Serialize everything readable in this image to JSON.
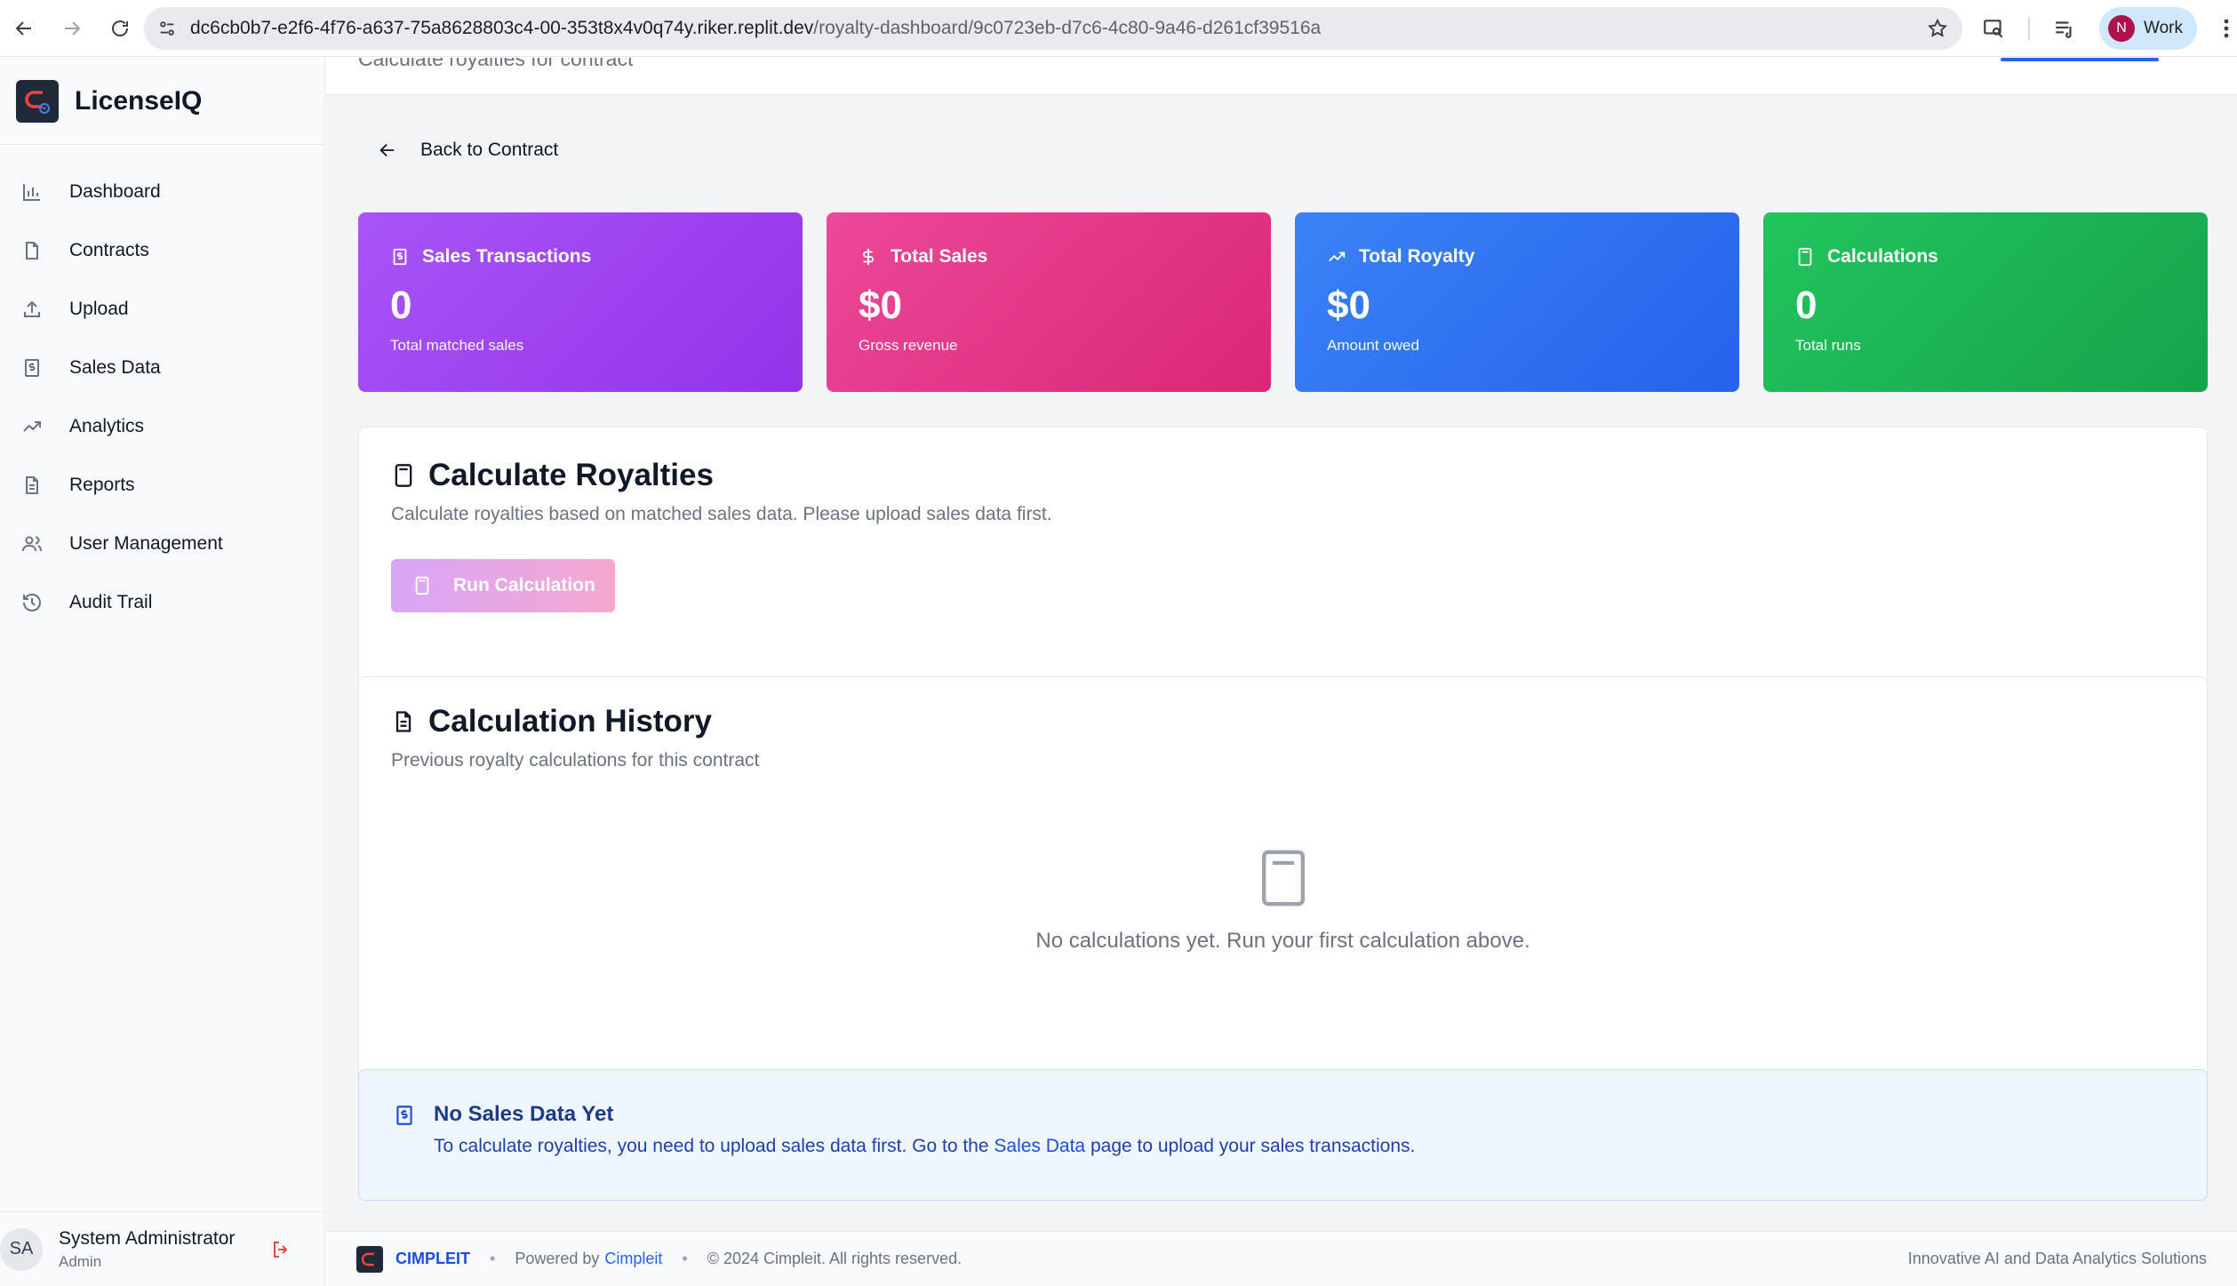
{
  "browser": {
    "url_host": "dc6cb0b7-e2f6-4f76-a637-75a8628803c4-00-353t8x4v0q74y.riker.replit.dev",
    "url_path": "/royalty-dashboard/9c0723eb-d7c6-4c80-9a46-d261cf39516a",
    "profile_initial": "N",
    "profile_label": "Work"
  },
  "app": {
    "name": "LicenseIQ"
  },
  "sidebar": {
    "items": [
      {
        "label": "Dashboard",
        "icon": "bar-chart-icon"
      },
      {
        "label": "Contracts",
        "icon": "file-icon"
      },
      {
        "label": "Upload",
        "icon": "upload-icon"
      },
      {
        "label": "Sales Data",
        "icon": "receipt-icon"
      },
      {
        "label": "Analytics",
        "icon": "trending-up-icon"
      },
      {
        "label": "Reports",
        "icon": "file-text-icon"
      },
      {
        "label": "User Management",
        "icon": "users-icon"
      },
      {
        "label": "Audit Trail",
        "icon": "history-icon"
      }
    ],
    "user": {
      "initials": "SA",
      "name": "System Administrator",
      "role": "Admin"
    }
  },
  "header": {
    "faded_subtitle": "Calculate royalties for contract"
  },
  "back_link": "Back to Contract",
  "stats": [
    {
      "title": "Sales Transactions",
      "value": "0",
      "sub": "Total matched sales",
      "color": "#9333ea"
    },
    {
      "title": "Total Sales",
      "value": "$0",
      "sub": "Gross revenue",
      "color": "#db2777"
    },
    {
      "title": "Total Royalty",
      "value": "$0",
      "sub": "Amount owed",
      "color": "#2563eb"
    },
    {
      "title": "Calculations",
      "value": "0",
      "sub": "Total runs",
      "color": "#16a34a"
    }
  ],
  "calculate": {
    "title": "Calculate Royalties",
    "description": "Calculate royalties based on matched sales data. Please upload sales data first.",
    "button": "Run Calculation"
  },
  "history": {
    "title": "Calculation History",
    "description": "Previous royalty calculations for this contract",
    "empty_message": "No calculations yet. Run your first calculation above."
  },
  "notice": {
    "title": "No Sales Data Yet",
    "text_before": "To calculate royalties, you need to upload sales data first. Go to the",
    "link": "Sales Data",
    "text_after": "page to upload your sales transactions."
  },
  "footer": {
    "brand": "CIMPLEIT",
    "powered_prefix": "Powered by",
    "powered_link": "Cimpleit",
    "copyright": "© 2024 Cimpleit. All rights reserved.",
    "tagline": "Innovative AI and Data Analytics Solutions"
  }
}
